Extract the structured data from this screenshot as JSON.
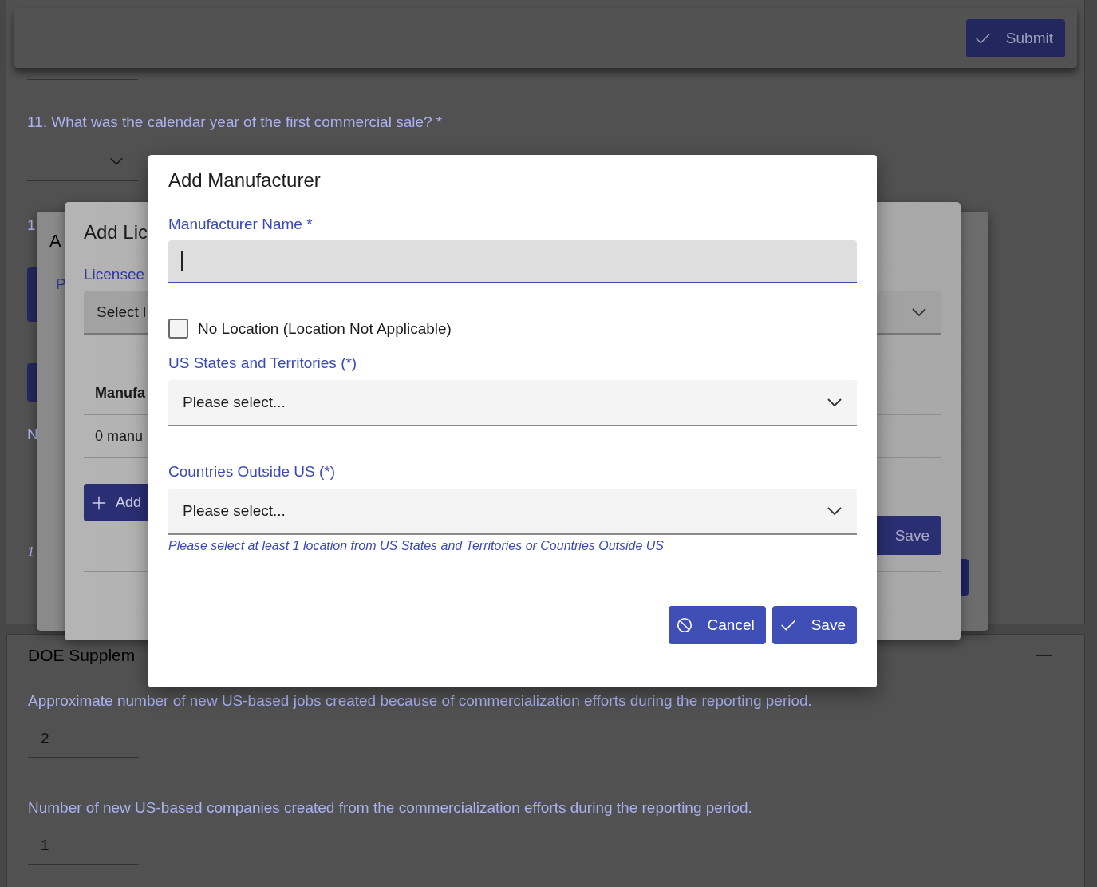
{
  "page": {
    "submit_button": "Submit",
    "question_11": {
      "label": "11. What was the calendar year of the first commercial sale? *"
    },
    "fragments": [
      {
        "kind": "label",
        "text": "1"
      },
      {
        "kind": "label",
        "text": "N"
      },
      {
        "kind": "note",
        "text": "1"
      }
    ],
    "doe_section": {
      "title": "DOE Supplem",
      "expanded": true,
      "questions": [
        {
          "label": "Approximate number of new US-based jobs created because of commercialization efforts during the reporting period.",
          "value": "2"
        },
        {
          "label": "Number of new US-based companies created from the commercialization efforts during the reporting period.",
          "value": "1"
        }
      ]
    }
  },
  "back_dialog": {
    "title": "A",
    "label": "P"
  },
  "licensee_dialog": {
    "title": "Add Lic",
    "licensee_label": "Licensee",
    "licensee_select": "Select l",
    "table_header": "Manufa",
    "table_row": "0 manu",
    "add_button": "Add",
    "save_button": "Save"
  },
  "dialog": {
    "title": "Add Manufacturer",
    "name_label": "Manufacturer Name *",
    "no_location": {
      "label": "No Location (Location Not Applicable)",
      "checked": false
    },
    "states_label": "US States and Territories (*)",
    "states_placeholder": "Please select...",
    "countries_label": "Countries Outside US (*)",
    "countries_placeholder": "Please select...",
    "hint": "Please select at least 1 location from US States and Territories or Countries Outside US",
    "buttons": [
      {
        "kind": "cancel",
        "label": "Cancel"
      },
      {
        "kind": "save",
        "label": "Save"
      }
    ]
  }
}
